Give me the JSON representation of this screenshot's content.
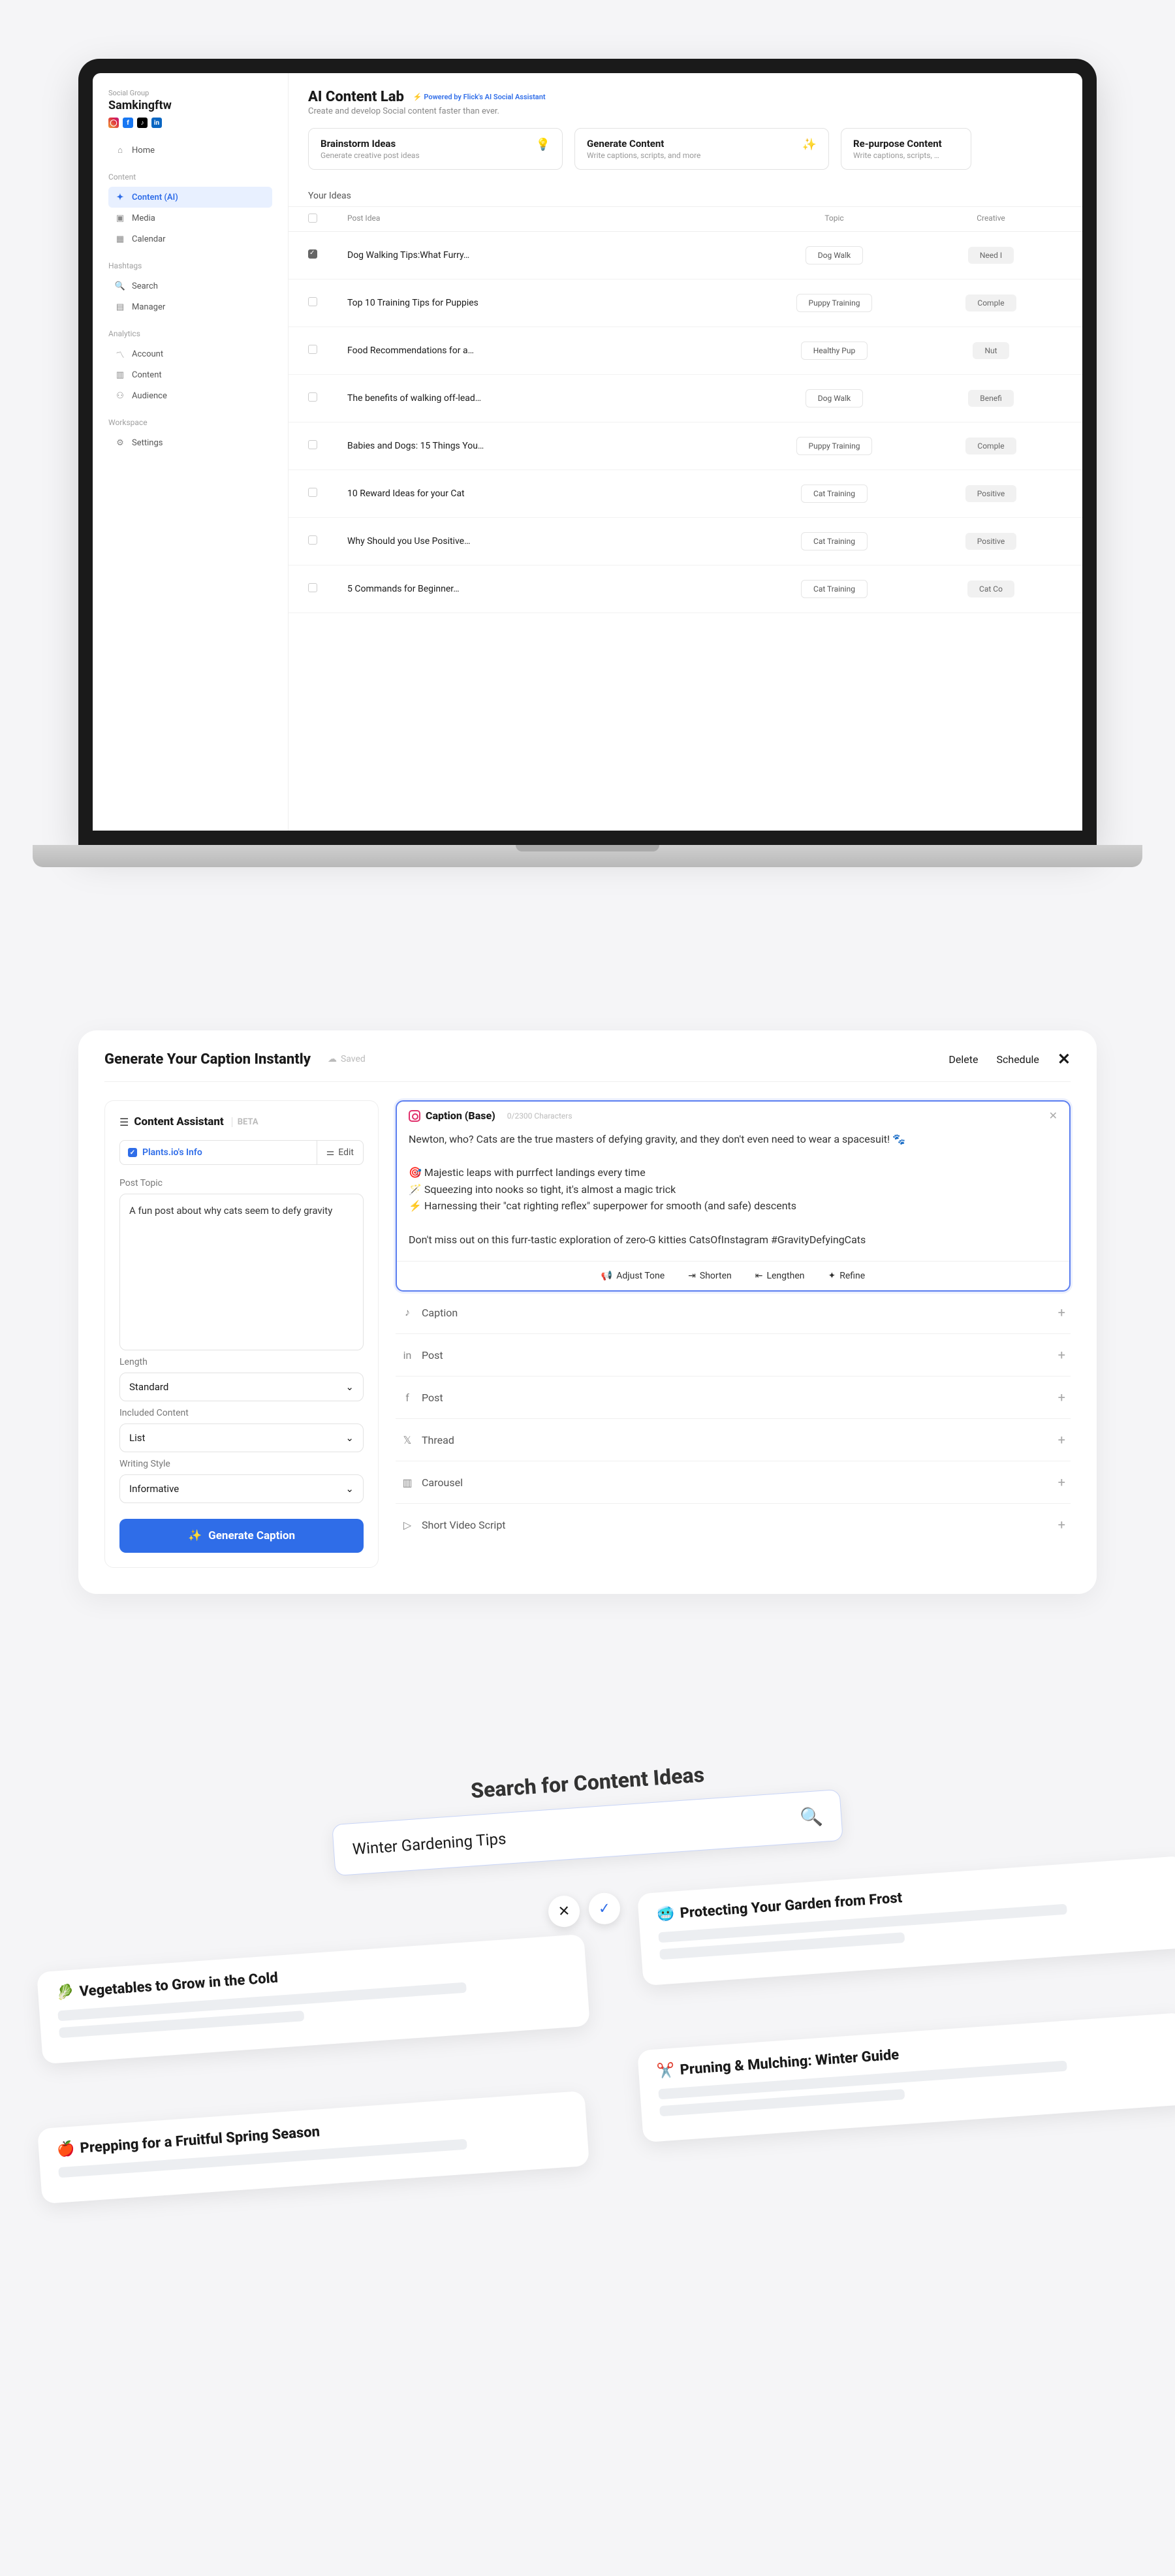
{
  "section1": {
    "sidebar": {
      "group_label": "Social Group",
      "workspace": "Samkingftw",
      "nav_home": "Home",
      "heading_content": "Content",
      "nav_content_ai": "Content (AI)",
      "nav_media": "Media",
      "nav_calendar": "Calendar",
      "heading_hashtags": "Hashtags",
      "nav_search": "Search",
      "nav_manager": "Manager",
      "heading_analytics": "Analytics",
      "nav_account": "Account",
      "nav_content": "Content",
      "nav_audience": "Audience",
      "heading_workspace": "Workspace",
      "nav_settings": "Settings"
    },
    "main": {
      "title": "AI Content Lab",
      "powered": "⚡ Powered by Flick's AI Social Assistant",
      "subtitle": "Create and develop Social content faster than ever.",
      "cards": {
        "brainstorm": {
          "title": "Brainstorm Ideas",
          "sub": "Generate creative post ideas"
        },
        "generate": {
          "title": "Generate Content",
          "sub": "Write captions, scripts, and more"
        },
        "repurpose": {
          "title": "Re-purpose Content",
          "sub": "Write captions, scripts, …"
        }
      },
      "your_ideas": "Your Ideas",
      "columns": {
        "post_idea": "Post Idea",
        "topic": "Topic",
        "creative": "Creative"
      },
      "rows": [
        {
          "checked": true,
          "title": "Dog Walking Tips:What Furry…",
          "topic": "Dog Walk",
          "creative": "Need I"
        },
        {
          "checked": false,
          "title": "Top 10 Training Tips for Puppies",
          "topic": "Puppy Training",
          "creative": "Comple"
        },
        {
          "checked": false,
          "title": "Food Recommendations for a…",
          "topic": "Healthy Pup",
          "creative": "Nut"
        },
        {
          "checked": false,
          "title": "The benefits of walking off-lead…",
          "topic": "Dog Walk",
          "creative": "Benefi"
        },
        {
          "checked": false,
          "title": "Babies and Dogs: 15 Things You…",
          "topic": "Puppy Training",
          "creative": "Comple"
        },
        {
          "checked": false,
          "title": "10 Reward Ideas for your Cat",
          "topic": "Cat Training",
          "creative": "Positive"
        },
        {
          "checked": false,
          "title": "Why Should you Use Positive…",
          "topic": "Cat Training",
          "creative": "Positive"
        },
        {
          "checked": false,
          "title": "5 Commands for Beginner…",
          "topic": "Cat Training",
          "creative": "Cat Co"
        }
      ]
    }
  },
  "section2": {
    "header": {
      "title": "Generate Your Caption Instantly",
      "saved": "Saved",
      "delete": "Delete",
      "schedule": "Schedule"
    },
    "assist": {
      "title": "Content Assistant",
      "beta": "BETA",
      "info_chip": "Plants.io's Info",
      "edit": "Edit",
      "post_topic_label": "Post Topic",
      "post_topic_value": "A fun post about why cats seem to defy gravity",
      "length_label": "Length",
      "length_value": "Standard",
      "included_label": "Included Content",
      "included_value": "List",
      "style_label": "Writing Style",
      "style_value": "Informative",
      "button": "Generate Caption"
    },
    "caption": {
      "label": "Caption (Base)",
      "chars": "0/2300 Characters",
      "body": "Newton, who? Cats are the true masters of defying gravity, and they don't even need to wear a spacesuit! 🐾\n\n🎯 Majestic leaps with purrfect landings every time\n🪄 Squeezing into nooks so tight, it's almost a magic trick\n⚡ Harnessing their \"cat righting reflex\" superpower for smooth (and safe) descents\n\nDon't miss out on this furr-tastic exploration of zero-G kitties CatsOfInstagram #GravityDefyingCats",
      "tools": {
        "adjust": "Adjust Tone",
        "shorten": "Shorten",
        "lengthen": "Lengthen",
        "refine": "Refine"
      }
    },
    "outputs": {
      "caption_tiktok": "Caption",
      "post_li": "Post",
      "post_fb": "Post",
      "thread": "Thread",
      "carousel": "Carousel",
      "short_video": "Short Video Script"
    }
  },
  "section3": {
    "title": "Search for Content Ideas",
    "search_value": "Winter Gardening Tips",
    "cards": {
      "veg": "Vegetables to Grow in the Cold",
      "frost": "Protecting Your Garden from Frost",
      "prep": "Prepping for a Fruitful Spring Season",
      "prune": "Pruning & Mulching: Winter Guide"
    }
  }
}
